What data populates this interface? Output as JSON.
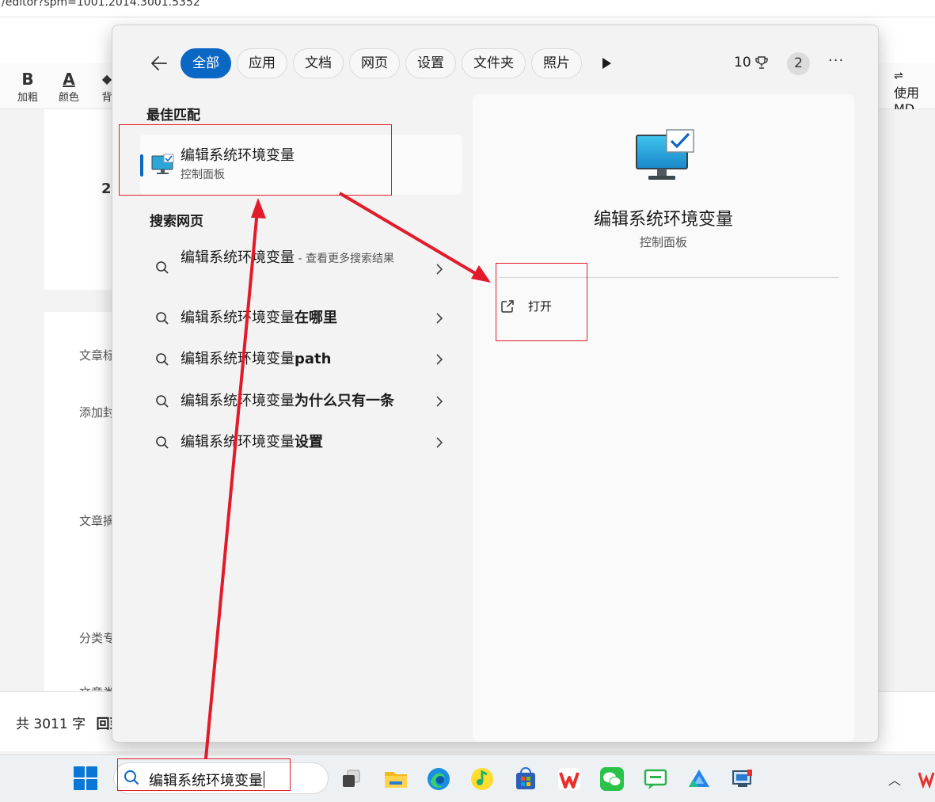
{
  "browser": {
    "url": "/editor?spm=1001.2014.3001.5352"
  },
  "editor": {
    "toolbar": [
      {
        "icon": "bold-icon",
        "glyph": "B",
        "label": "加粗"
      },
      {
        "icon": "font-color-icon",
        "glyph": "A",
        "label": "颜色"
      },
      {
        "icon": "background-color-icon",
        "glyph": "◆",
        "label": "背"
      }
    ],
    "toolbar_right_label": "使用 MD",
    "partial_number": "2",
    "side_labels": [
      "文章标",
      "添加封",
      "文章摘",
      "分类专",
      "文章类"
    ],
    "footer": {
      "word_count": "共 3011 字",
      "back_to_top": "回到"
    }
  },
  "search_panel": {
    "filters": [
      {
        "label": "全部",
        "active": true
      },
      {
        "label": "应用",
        "active": false
      },
      {
        "label": "文档",
        "active": false
      },
      {
        "label": "网页",
        "active": false
      },
      {
        "label": "设置",
        "active": false
      },
      {
        "label": "文件夹",
        "active": false
      },
      {
        "label": "照片",
        "active": false
      }
    ],
    "rewards_points": "10",
    "notification_count": "2",
    "more_label": "···",
    "best_match": {
      "heading": "最佳匹配",
      "title": "编辑系统环境变量",
      "subtitle": "控制面板"
    },
    "web_search": {
      "heading": "搜索网页",
      "results": [
        {
          "base": "编辑系统环境变量",
          "bold": "",
          "hint": " - 查看更多搜索结果"
        },
        {
          "base": "编辑系统环境变量",
          "bold": "在哪里",
          "hint": ""
        },
        {
          "base": "编辑系统环境变量",
          "bold": "path",
          "hint": ""
        },
        {
          "base": "编辑系统环境变量",
          "bold": "为什么只有一条",
          "hint": ""
        },
        {
          "base": "编辑系统环境变量",
          "bold": "设置",
          "hint": ""
        }
      ]
    },
    "preview": {
      "title": "编辑系统环境变量",
      "subtitle": "控制面板",
      "actions": [
        {
          "label": "打开",
          "icon": "open-external-icon"
        }
      ]
    }
  },
  "taskbar": {
    "search_value": "编辑系统环境变量",
    "apps": [
      "task-view",
      "file-explorer",
      "edge",
      "qq-music",
      "microsoft-store",
      "wps",
      "wechat",
      "messages",
      "cloud-drive",
      "network-control"
    ]
  },
  "colors": {
    "accent": "#0b67c4",
    "annotation_red": "#e21b2b"
  }
}
